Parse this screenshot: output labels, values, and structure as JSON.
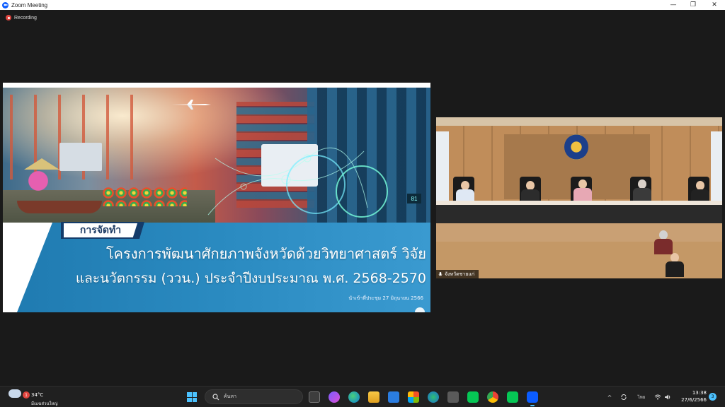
{
  "window": {
    "title": "Zoom Meeting",
    "controls": {
      "minimize": "—",
      "maximize": "❐",
      "close": "✕"
    }
  },
  "recording": {
    "label": "Recording"
  },
  "slide": {
    "tag": "การจัดทำ",
    "line1": "โครงการพัฒนาศักยภาพจังหวัดด้วยวิทยาศาสตร์ วิจัย",
    "line2": "และนวัตกรรม (ววน.) ประจำปีงบประมาณ พ.ศ. 2568-2570",
    "note": "นำเข้าที่ประชุม 27 มิถุนายน 2566",
    "hud_number": "81"
  },
  "video": {
    "participant_name": "จังหวัดชายแก่"
  },
  "taskbar": {
    "weather": {
      "badge": "1",
      "temp": "34°C",
      "condition": "มีเมฆส่วนใหญ่"
    },
    "search_placeholder": "ค้นหา",
    "apps": [
      "task-view",
      "copilot",
      "edge",
      "file-explorer",
      "mail",
      "microsoft-store",
      "browser",
      "calculator",
      "line",
      "chrome",
      "line",
      "zoom"
    ],
    "tray": {
      "chevron": "^",
      "language": "ไทย",
      "wifi": "wifi",
      "volume": "volume"
    },
    "clock": {
      "time": "13:38",
      "date": "27/6/2566"
    },
    "notification_count": "3"
  },
  "colors": {
    "titlebar": "#ffffff",
    "stage": "#1a1a1a",
    "slide_band": "#2a8ac0",
    "slide_tag": "#1f3d66",
    "taskbar": "#202020",
    "accent": "#4cc2ff",
    "zoom_blue": "#0b5cff"
  }
}
